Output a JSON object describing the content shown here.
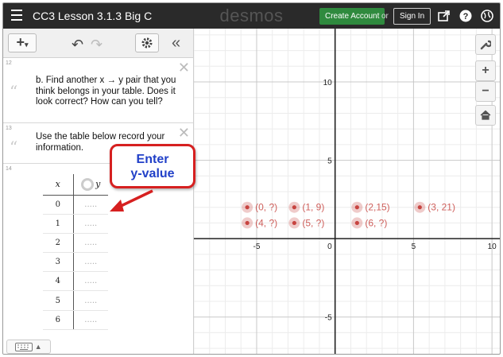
{
  "topbar": {
    "title": "CC3 Lesson 3.1.3 Big C",
    "brand": "desmos",
    "create_account": "Create Account",
    "or": "or",
    "sign_in": "Sign In"
  },
  "notes": [
    {
      "number": "12",
      "text": "b. Find another x → y pair that you think belongs in your table. Does it look correct? How can you tell?"
    },
    {
      "number": "13",
      "text": "Use the table below record your information."
    }
  ],
  "table": {
    "number": "14",
    "header_x": "x",
    "header_y": "y",
    "rows": [
      {
        "x": "0",
        "y": "....."
      },
      {
        "x": "1",
        "y": "....."
      },
      {
        "x": "2",
        "y": "....."
      },
      {
        "x": "3",
        "y": "....."
      },
      {
        "x": "4",
        "y": "....."
      },
      {
        "x": "5",
        "y": "....."
      },
      {
        "x": "6",
        "y": "....."
      }
    ]
  },
  "callout": {
    "line1": "Enter",
    "line2": "y-value",
    "color": "#d62020",
    "text_color": "#2140c8"
  },
  "graph": {
    "x_ticks": [
      "-5",
      "0",
      "5",
      "10"
    ],
    "y_ticks": [
      "10",
      "5",
      "-5"
    ],
    "points": [
      {
        "x": -5.6,
        "y": 2,
        "label": "(0, ?)"
      },
      {
        "x": -2.6,
        "y": 2,
        "label": "(1, 9)"
      },
      {
        "x": 1.4,
        "y": 2,
        "label": "(2,15)"
      },
      {
        "x": 5.4,
        "y": 2,
        "label": "(3, 21)"
      },
      {
        "x": -5.6,
        "y": 1,
        "label": "(4, ?)"
      },
      {
        "x": -2.6,
        "y": 1,
        "label": "(5, ?)"
      },
      {
        "x": 1.4,
        "y": 1,
        "label": "(6, ?)"
      }
    ],
    "point_color": "#c74440",
    "xlim": [
      -9,
      10.5
    ],
    "ylim": [
      -7.4,
      13.4
    ]
  }
}
